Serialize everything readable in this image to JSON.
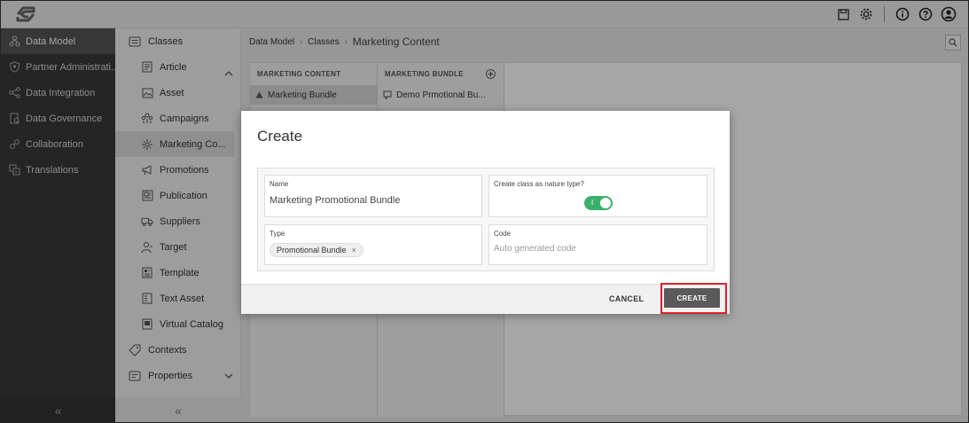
{
  "leftnav": {
    "items": [
      {
        "label": "Data Model",
        "icon": "data-model-icon",
        "active": true
      },
      {
        "label": "Partner Administrati...",
        "icon": "shield-icon",
        "active": false
      },
      {
        "label": "Data Integration",
        "icon": "integration-icon",
        "active": false
      },
      {
        "label": "Data Governance",
        "icon": "governance-icon",
        "active": false
      },
      {
        "label": "Collaboration",
        "icon": "collaboration-icon",
        "active": false
      },
      {
        "label": "Translations",
        "icon": "translations-icon",
        "active": false
      }
    ],
    "collapse": "«"
  },
  "subnav": {
    "classes_label": "Classes",
    "items": [
      {
        "label": "Article",
        "icon": "article-icon"
      },
      {
        "label": "Asset",
        "icon": "asset-icon"
      },
      {
        "label": "Campaigns",
        "icon": "campaigns-icon"
      },
      {
        "label": "Marketing Co...",
        "icon": "marketing-content-icon",
        "active": true
      },
      {
        "label": "Promotions",
        "icon": "megaphone-icon"
      },
      {
        "label": "Publication",
        "icon": "publication-icon"
      },
      {
        "label": "Suppliers",
        "icon": "truck-icon"
      },
      {
        "label": "Target",
        "icon": "target-icon"
      },
      {
        "label": "Template",
        "icon": "template-icon"
      },
      {
        "label": "Text Asset",
        "icon": "text-asset-icon"
      },
      {
        "label": "Virtual Catalog",
        "icon": "virtual-catalog-icon"
      }
    ],
    "contexts_label": "Contexts",
    "properties_label": "Properties",
    "collapse": "«"
  },
  "breadcrumb": {
    "level1": "Data Model",
    "level2": "Classes",
    "current": "Marketing Content",
    "separator": "›"
  },
  "columns": {
    "col1_header": "MARKETING CONTENT",
    "col1_row": "Marketing Bundle",
    "col2_header": "MARKETING BUNDLE",
    "col2_row": "Demo Prmotional Bu..."
  },
  "dialog": {
    "title": "Create",
    "name_label": "Name",
    "name_value": "Marketing Promotional Bundle",
    "nature_label": "Create class as nature type?",
    "toggle_mark": "I",
    "nature_enabled": true,
    "type_label": "Type",
    "type_chip": "Promotional Bundle",
    "chip_remove": "×",
    "code_label": "Code",
    "code_placeholder": "Auto generated code",
    "cancel_label": "CANCEL",
    "create_label": "CREATE"
  },
  "colors": {
    "toggle_on": "#3bb06a",
    "highlight": "#d8232a",
    "create_button": "#5a5a5a"
  }
}
